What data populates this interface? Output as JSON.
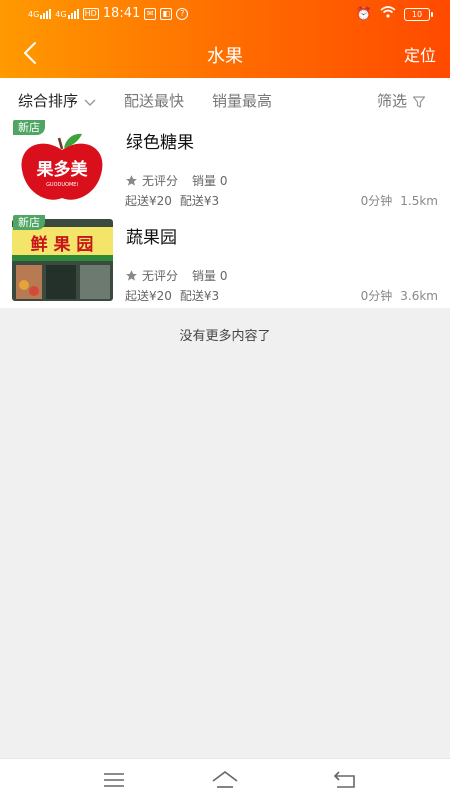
{
  "status": {
    "time": "18:41",
    "net1": "4G",
    "net2": "4G",
    "hd": "HD",
    "battery": "10"
  },
  "header": {
    "title": "水果",
    "locate_label": "定位"
  },
  "filters": [
    {
      "label": "综合排序",
      "active": true
    },
    {
      "label": "配送最快",
      "active": false
    },
    {
      "label": "销量最高",
      "active": false
    },
    {
      "label": "筛选",
      "active": false
    }
  ],
  "shops": [
    {
      "tag": "新店",
      "name": "绿色糖果",
      "logo_text": "果多美",
      "logo_sub": "GUODUOMEI",
      "rating": "无评分",
      "sales": "销量 0",
      "min_order": "起送¥20",
      "delivery_fee": "配送¥3",
      "time": "0分钟",
      "distance": "1.5km"
    },
    {
      "tag": "新店",
      "name": "蔬果园",
      "logo_text": "鲜 果 园",
      "rating": "无评分",
      "sales": "销量 0",
      "min_order": "起送¥20",
      "delivery_fee": "配送¥3",
      "time": "0分钟",
      "distance": "3.6km"
    }
  ],
  "footer_text": "没有更多内容了",
  "colors": {
    "header_start": "#ff9a00",
    "header_end": "#ff4a00",
    "new_tag": "#4fa564"
  }
}
